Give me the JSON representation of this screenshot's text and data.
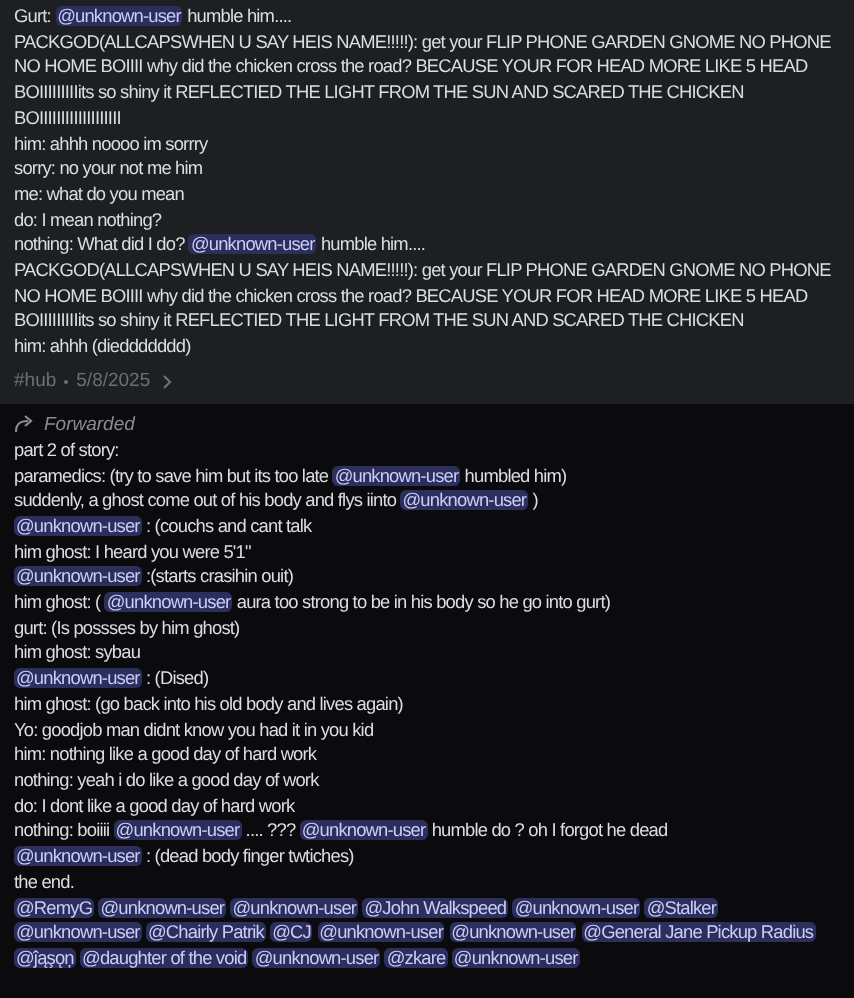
{
  "messages": [
    {
      "lines": [
        [
          {
            "kind": "text",
            "text": "Gurt: "
          },
          {
            "kind": "mention",
            "text": "@unknown-user"
          },
          {
            "kind": "text",
            "text": " humble him...."
          }
        ],
        [
          {
            "kind": "text",
            "text": "PACKGOD(ALLCAPSWHEN U SAY HEIS NAME!!!!!): get your FLIP PHONE GARDEN GNOME NO PHONE NO HOME BOIIII why did the chicken cross the road? BECAUSE YOUR FOR HEAD MORE LIKE 5 HEAD BOIIIIIIIIIits so shiny it REFLECTIED THE LIGHT FROM THE SUN AND SCARED THE CHICKEN BOIIIIIIIIIIIIIIIIIII"
          }
        ],
        [
          {
            "kind": "text",
            "text": "him: ahhh noooo im sorrry"
          }
        ],
        [
          {
            "kind": "text",
            "text": "sorry: no your not me him"
          }
        ],
        [
          {
            "kind": "text",
            "text": "me: what do you mean"
          }
        ],
        [
          {
            "kind": "text",
            "text": "do: I mean nothing?"
          }
        ],
        [
          {
            "kind": "text",
            "text": "nothing: What did I do? "
          },
          {
            "kind": "mention",
            "text": "@unknown-user"
          },
          {
            "kind": "text",
            "text": " humble him...."
          }
        ],
        [
          {
            "kind": "text",
            "text": "PACKGOD(ALLCAPSWHEN U SAY HEIS NAME!!!!!): get your FLIP PHONE GARDEN GNOME NO PHONE NO HOME BOIIII why did the chicken cross the road? BECAUSE YOUR FOR HEAD MORE LIKE 5 HEAD BOIIIIIIIIIits so shiny it REFLECTIED THE LIGHT FROM THE SUN AND SCARED THE CHICKEN"
          }
        ],
        [
          {
            "kind": "text",
            "text": "him: ahhh (dieddddddd)"
          }
        ]
      ],
      "channel": "#hub",
      "date": "5/8/2025"
    },
    {
      "forwarded": "Forwarded",
      "lines": [
        [
          {
            "kind": "text",
            "text": "part 2 of story:"
          }
        ],
        [
          {
            "kind": "text",
            "text": "paramedics: (try to save him but its too late "
          },
          {
            "kind": "mention",
            "text": "@unknown-user"
          },
          {
            "kind": "text",
            "text": " humbled him)"
          }
        ],
        [
          {
            "kind": "text",
            "text": "suddenly, a ghost come out of his body and flys iinto "
          },
          {
            "kind": "mention",
            "text": "@unknown-user"
          },
          {
            "kind": "text",
            "text": " )"
          }
        ],
        [
          {
            "kind": "mention",
            "text": "@unknown-user"
          },
          {
            "kind": "text",
            "text": " : (couchs and cant talk"
          }
        ],
        [
          {
            "kind": "text",
            "text": "him ghost: I heard you were 5'1\""
          }
        ],
        [
          {
            "kind": "mention",
            "text": "@unknown-user"
          },
          {
            "kind": "text",
            "text": " :(starts crasihin ouit)"
          }
        ],
        [
          {
            "kind": "text",
            "text": "him ghost: ( "
          },
          {
            "kind": "mention",
            "text": "@unknown-user"
          },
          {
            "kind": "text",
            "text": " aura too strong to be in his body so he go into gurt)"
          }
        ],
        [
          {
            "kind": "text",
            "text": "gurt: (Is possses by him ghost)"
          }
        ],
        [
          {
            "kind": "text",
            "text": "him ghost: sybau"
          }
        ],
        [
          {
            "kind": "mention",
            "text": "@unknown-user"
          },
          {
            "kind": "text",
            "text": " : (Dised)"
          }
        ],
        [
          {
            "kind": "text",
            "text": "him ghost: (go back into his old body and lives again)"
          }
        ],
        [
          {
            "kind": "text",
            "text": "Yo: goodjob man didnt know you had it in you kid"
          }
        ],
        [
          {
            "kind": "text",
            "text": "him: nothing like a good day of hard work"
          }
        ],
        [
          {
            "kind": "text",
            "text": "nothing: yeah i do like a good day of work"
          }
        ],
        [
          {
            "kind": "text",
            "text": "do: I dont like a good day of hard work"
          }
        ],
        [
          {
            "kind": "text",
            "text": "nothing: boiiii "
          },
          {
            "kind": "mention",
            "text": "@unknown-user"
          },
          {
            "kind": "text",
            "text": " .... ??? "
          },
          {
            "kind": "mention",
            "text": "@unknown-user"
          },
          {
            "kind": "text",
            "text": " humble do ? oh I forgot he dead"
          }
        ],
        [
          {
            "kind": "mention",
            "text": "@unknown-user"
          },
          {
            "kind": "text",
            "text": " : (dead body finger twtiches)"
          }
        ],
        [
          {
            "kind": "text",
            "text": "the end."
          }
        ],
        [
          {
            "kind": "mention",
            "text": "@RemyG"
          },
          {
            "kind": "mention",
            "text": "@unknown-user"
          },
          {
            "kind": "mention",
            "text": "@unknown-user"
          },
          {
            "kind": "mention",
            "text": "@John Walkspeed"
          },
          {
            "kind": "mention",
            "text": "@unknown-user"
          },
          {
            "kind": "mention",
            "text": "@Stalker"
          },
          {
            "kind": "mention",
            "text": "@unknown-user"
          },
          {
            "kind": "mention",
            "text": "@Chairly Patrik"
          },
          {
            "kind": "mention",
            "text": "@CJ"
          },
          {
            "kind": "mention",
            "text": "@unknown-user"
          },
          {
            "kind": "mention",
            "text": "@unknown-user"
          },
          {
            "kind": "mention",
            "text": "@General Jane Pickup Radius"
          },
          {
            "kind": "mention",
            "text": "@ĵąşǫņ"
          },
          {
            "kind": "mention",
            "text": "@daughter of the void"
          },
          {
            "kind": "mention",
            "text": "@unknown-user"
          },
          {
            "kind": "mention",
            "text": "@zkare"
          },
          {
            "kind": "mention",
            "text": "@unknown-user"
          }
        ]
      ]
    }
  ]
}
